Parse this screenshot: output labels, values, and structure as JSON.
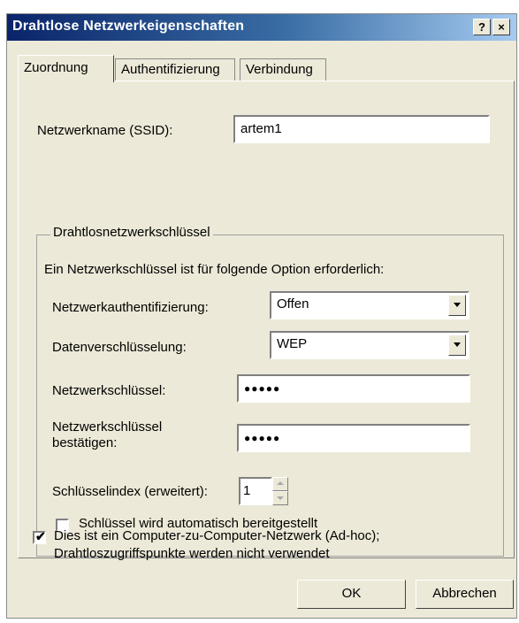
{
  "dialog": {
    "title": "Drahtlose Netzwerkeigenschaften",
    "help_label": "?",
    "close_label": "×"
  },
  "tabs": [
    {
      "label": "Zuordnung"
    },
    {
      "label": "Authentifizierung"
    },
    {
      "label": "Verbindung"
    }
  ],
  "ssid": {
    "label": "Netzwerkname (SSID):",
    "value": "artem1"
  },
  "group": {
    "legend": "Drahtlosnetzwerkschlüssel",
    "intro": "Ein Netzwerkschlüssel ist für folgende Option erforderlich:",
    "auth": {
      "label": "Netzwerkauthentifizierung:",
      "value": "Offen"
    },
    "encryption": {
      "label": "Datenverschlüsselung:",
      "value": "WEP"
    },
    "key": {
      "label": "Netzwerkschlüssel:",
      "value": "●●●●●"
    },
    "key_confirm": {
      "label_line1": "Netzwerkschlüssel",
      "label_line2": "bestätigen:",
      "value": "●●●●●"
    },
    "key_index": {
      "label": "Schlüsselindex (erweitert):",
      "value": "1"
    },
    "auto_key": {
      "label": "Schlüssel wird automatisch bereitgestellt",
      "checked": false
    }
  },
  "adhoc": {
    "label_line1": "Dies ist ein Computer-zu-Computer-Netzwerk (Ad-hoc);",
    "label_line2": "Drahtloszugriffspunkte werden nicht verwendet",
    "checked": true,
    "check_glyph": "✔"
  },
  "buttons": {
    "ok": "OK",
    "cancel": "Abbrechen"
  }
}
